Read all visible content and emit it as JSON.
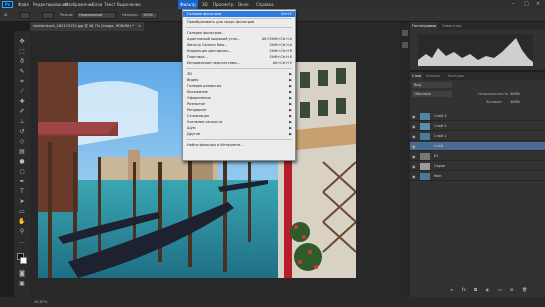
{
  "menubar": {
    "logo": "Ps",
    "items": [
      "Файл",
      "Редактирование",
      "Изображение",
      "Слои",
      "Текст",
      "Выделение",
      "Фильтр",
      "3D",
      "Просмотр",
      "Окно",
      "Справка"
    ],
    "active_index": 6
  },
  "options": {
    "mode_label": "Режим:",
    "mode_value": "Нормальный",
    "opacity_label": "Непрозр.:",
    "opacity_value": "100%"
  },
  "document_tab": "shutterstock_182103152.jpg @ 46,7% (Image, RGB/8#) *",
  "filter_menu": {
    "items": [
      {
        "label": "Галерея фильтров",
        "shortcut": "Ctrl+F",
        "highlighted": true
      },
      {
        "separator": true
      },
      {
        "label": "Преобразовать для смарт-фильтров"
      },
      {
        "separator": true
      },
      {
        "label": "Галерея фильтров..."
      },
      {
        "label": "Адаптивный широкий угол...",
        "shortcut": "Alt+Shift+Ctrl+A"
      },
      {
        "label": "Фильтр Camera Raw...",
        "shortcut": "Shift+Ctrl+A"
      },
      {
        "label": "Коррекция дисторсии...",
        "shortcut": "Shift+Ctrl+R"
      },
      {
        "label": "Пластика...",
        "shortcut": "Shift+Ctrl+X"
      },
      {
        "label": "Исправление перспективы...",
        "shortcut": "Alt+Ctrl+V"
      },
      {
        "separator": true
      },
      {
        "label": "3D",
        "submenu": true
      },
      {
        "label": "Видео",
        "submenu": true
      },
      {
        "label": "Галерея размытия",
        "submenu": true
      },
      {
        "label": "Искажение",
        "submenu": true
      },
      {
        "label": "Оформление",
        "submenu": true
      },
      {
        "label": "Размытие",
        "submenu": true
      },
      {
        "label": "Рендеринг",
        "submenu": true
      },
      {
        "label": "Стилизация",
        "submenu": true
      },
      {
        "label": "Усиление резкости",
        "submenu": true
      },
      {
        "label": "Шум",
        "submenu": true
      },
      {
        "label": "Другое",
        "submenu": true
      },
      {
        "separator": true
      },
      {
        "label": "Найти фильтры в Интернете..."
      }
    ]
  },
  "histogram_panel": {
    "tabs": [
      "Гистограмма",
      "Навигатор"
    ]
  },
  "layers_panel": {
    "tabs": [
      "Слои",
      "Каналы",
      "Контуры"
    ],
    "kind_label": "Вид",
    "blend_mode": "Обычные",
    "opacity_label": "Непрозрачность:",
    "opacity_value": "100%",
    "fill_label": "Заливка:",
    "fill_value": "100%",
    "layers": [
      {
        "name": "Слой 3",
        "thumb": "#4f86a8"
      },
      {
        "name": "Слой 2",
        "thumb": "#5b8fb0"
      },
      {
        "name": "Слой 1",
        "thumb": "#4a7c9c"
      },
      {
        "name": "Слой",
        "thumb": "#3e6f92",
        "selected": true
      },
      {
        "name": "Б1",
        "thumb": "#777777"
      },
      {
        "name": "Серое",
        "thumb": "#9a9a9a"
      },
      {
        "name": "Фон",
        "thumb": "#4a7a96"
      }
    ]
  },
  "status": {
    "zoom": "46,67%"
  }
}
